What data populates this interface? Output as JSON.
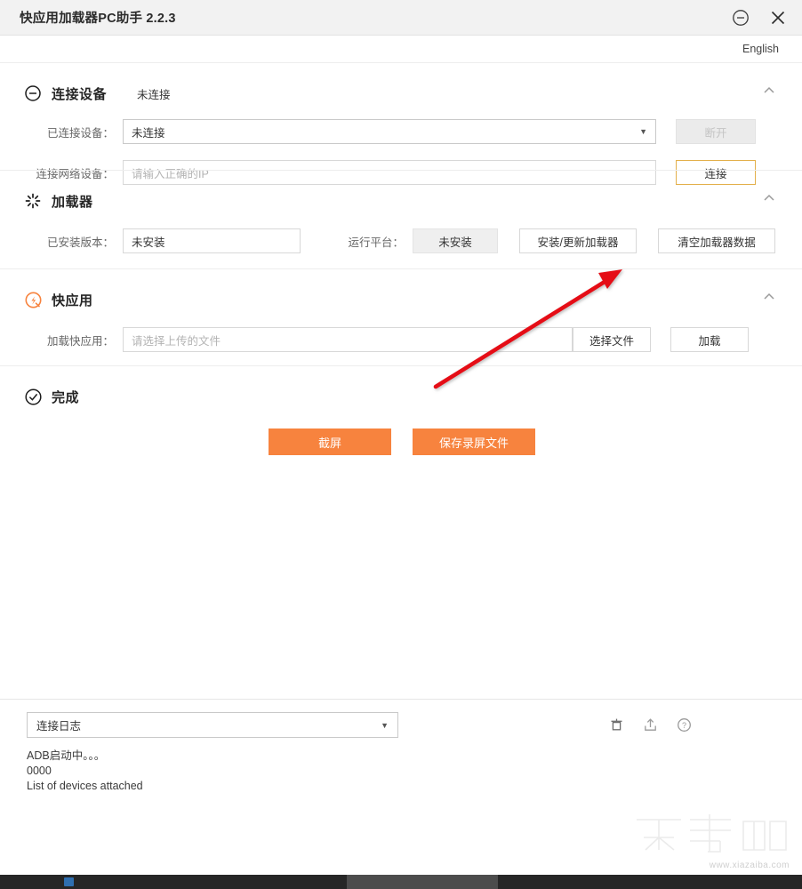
{
  "window": {
    "title": "快应用加载器PC助手 2.2.3",
    "minimize_icon": "minimize-circle-icon",
    "close_icon": "close-icon"
  },
  "language": {
    "label": "English"
  },
  "sections": {
    "device": {
      "icon": "minus-circle-icon",
      "title": "连接设备",
      "status": "未连接",
      "collapse_icon": "chevron-up-icon",
      "connected_device": {
        "label": "已连接设备：",
        "value": "未连接",
        "caret": "▼"
      },
      "disconnect_button": "断开",
      "network_device": {
        "label": "连接网络设备：",
        "placeholder": "请输入正确的IP",
        "value": ""
      },
      "connect_button": "连接"
    },
    "loader": {
      "icon": "spinner-icon",
      "title": "加载器",
      "collapse_icon": "chevron-up-icon",
      "installed_version": {
        "label": "已安装版本：",
        "value": "未安装"
      },
      "platform": {
        "label": "运行平台：",
        "value": "未安装"
      },
      "install_update_button": "安装/更新加载器",
      "clear_data_button": "清空加载器数据"
    },
    "quickapp": {
      "icon": "quickapp-logo-icon",
      "title": "快应用",
      "collapse_icon": "chevron-up-icon",
      "load_field": {
        "label": "加载快应用：",
        "placeholder": "请选择上传的文件",
        "value": ""
      },
      "choose_file_button": "选择文件",
      "load_button": "加载"
    },
    "finish": {
      "icon": "check-circle-icon",
      "title": "完成",
      "screenshot_button": "截屏",
      "save_recording_button": "保存录屏文件"
    }
  },
  "log": {
    "selector_value": "连接日志",
    "selector_caret": "▼",
    "icons": {
      "clear": "trash-icon",
      "export": "upload-icon",
      "help": "help-circle-icon"
    },
    "lines": [
      "ADB启动中。。。",
      "0000",
      "List of devices attached"
    ]
  },
  "watermark": {
    "text": "下载吧",
    "url": "www.xiazaiba.com"
  },
  "annotation": {
    "arrow_color": "#e50914"
  },
  "colors": {
    "accent_orange": "#f7833e",
    "gold_border": "#e3b04b",
    "titlebar_bg": "#f2f2f2"
  }
}
